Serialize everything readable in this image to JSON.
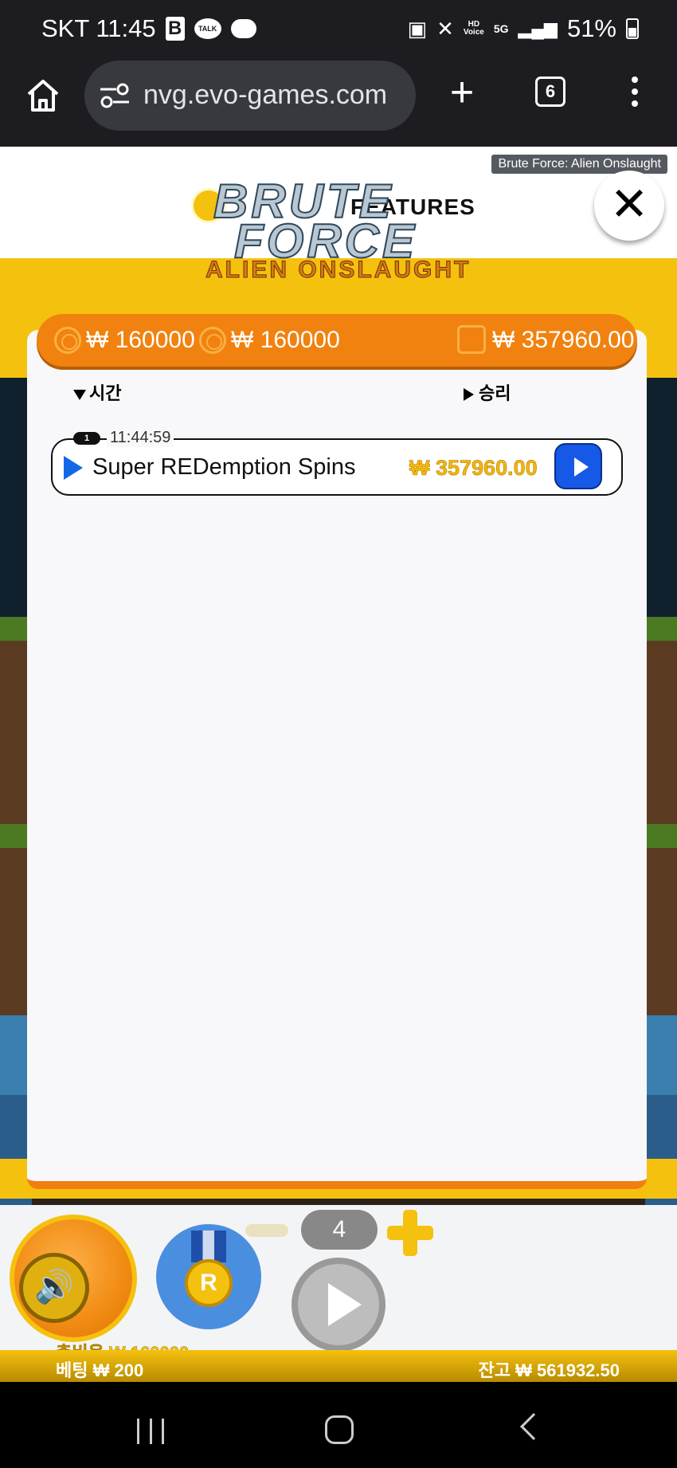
{
  "status_bar": {
    "carrier_time": "SKT 11:45",
    "b_icon_label": "B",
    "talk_label": "TALK",
    "hd_top": "HD",
    "hd_bottom": "Voice",
    "network": "5G",
    "battery": "51%"
  },
  "browser": {
    "url": "nvg.evo-games.com",
    "tab_count": "6"
  },
  "game": {
    "title_tooltip": "Brute Force: Alien Onslaught",
    "close_label": "✕",
    "logo": {
      "word1": "BRUTE",
      "word2": "FORCE",
      "subtitle": "ALIEN ONSLAUGHT",
      "behind_text": "FEATURES"
    },
    "panel": {
      "header": {
        "value1": "₩ 160000",
        "value2": "₩ 160000",
        "balance": "₩ 357960.00"
      },
      "columns": {
        "time": "시간",
        "win": "승리"
      },
      "rows": [
        {
          "index": "1",
          "time": "11:44:59",
          "name": "Super REDemption Spins",
          "amount": "₩ 357960.00"
        }
      ]
    },
    "controls": {
      "speaker_icon": "speaker-icon",
      "medal_letter": "R",
      "count": "4",
      "total_cost": "총비용 ₩ 160000"
    },
    "bet_bar": {
      "bet": "베팅  ₩ 200",
      "balance": "잔고  ₩ 561932.50"
    }
  }
}
